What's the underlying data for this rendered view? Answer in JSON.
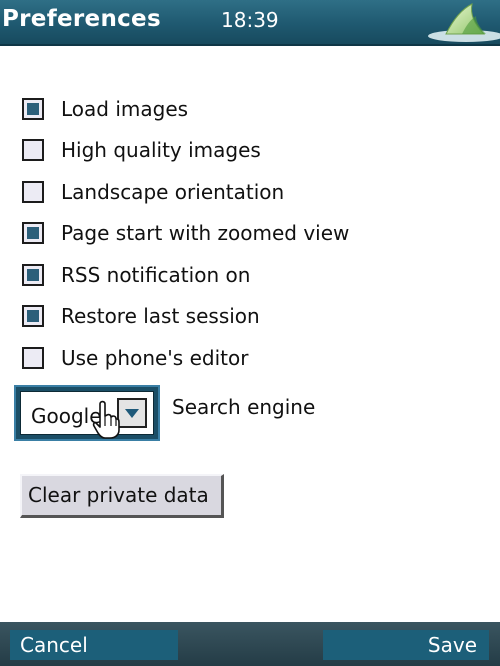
{
  "titlebar": {
    "title": "Preferences",
    "clock": "18:39",
    "logo_icon": "shark-fin-logo-icon"
  },
  "options": [
    {
      "label": "Load images",
      "checked": true
    },
    {
      "label": "High quality images",
      "checked": false
    },
    {
      "label": "Landscape orientation",
      "checked": false
    },
    {
      "label": "Page start with zoomed view",
      "checked": true
    },
    {
      "label": "RSS notification on",
      "checked": true
    },
    {
      "label": "Restore last session",
      "checked": true
    },
    {
      "label": "Use phone's editor",
      "checked": false
    }
  ],
  "search_engine": {
    "value": "Google",
    "caption": "Search engine",
    "arrow_icon": "chevron-down-icon"
  },
  "clear_button": {
    "label": "Clear private data"
  },
  "softkeys": {
    "left": "Cancel",
    "right": "Save"
  },
  "colors": {
    "titlebar": "#1f5970",
    "checkbox_fill": "#2b5f7a",
    "softkey": "#1c5f79"
  }
}
